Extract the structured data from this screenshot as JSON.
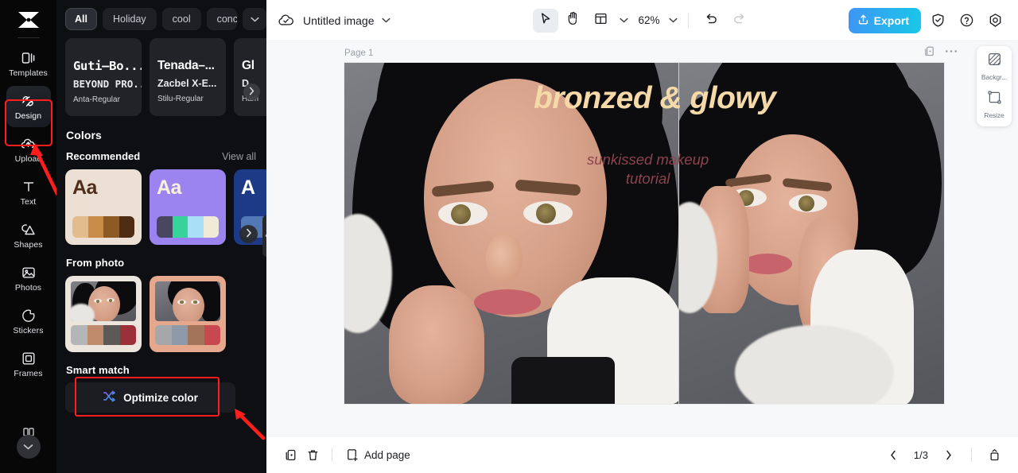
{
  "app": {
    "brand_icon": "capcut-logo-icon",
    "accent": "#ff1d1d",
    "export_gradient_from": "#3e95f5",
    "export_gradient_to": "#18c8e8"
  },
  "rail": {
    "items": [
      {
        "label": "Templates",
        "icon": "templates-icon",
        "active": false
      },
      {
        "label": "Design",
        "icon": "design-icon",
        "active": true
      },
      {
        "label": "Upload",
        "icon": "upload-cloud-icon",
        "active": false
      },
      {
        "label": "Text",
        "icon": "text-icon",
        "active": false
      },
      {
        "label": "Shapes",
        "icon": "shapes-icon",
        "active": false
      },
      {
        "label": "Photos",
        "icon": "photos-icon",
        "active": false
      },
      {
        "label": "Stickers",
        "icon": "stickers-icon",
        "active": false
      },
      {
        "label": "Frames",
        "icon": "frames-icon",
        "active": false
      }
    ],
    "collapse_icon": "chevron-down-icon"
  },
  "panel": {
    "tags": [
      {
        "label": "All",
        "selected": true
      },
      {
        "label": "Holiday",
        "selected": false
      },
      {
        "label": "cool",
        "selected": false
      },
      {
        "label": "concise",
        "selected": false
      }
    ],
    "tag_more_icon": "chevron-down-icon",
    "font_cards": [
      {
        "line1": "Guti–Bo...",
        "line2": "BEYOND PRO...",
        "line3": "Anta-Regular",
        "mono": true
      },
      {
        "line1": "Tenada–...",
        "line2": "Zacbel X-E...",
        "line3": "Stilu-Regular",
        "mono": false
      },
      {
        "line1": "Gl",
        "line2": "D",
        "line3": "Ham",
        "mono": false
      }
    ],
    "colors_heading": "Colors",
    "recommended_label": "Recommended",
    "view_all_label": "View all",
    "palettes": [
      {
        "bg": "#ece0d4",
        "aa": "Aa",
        "aa_color": "#4e2f1c",
        "swatches": [
          "#e3bc8e",
          "#c98b47",
          "#8c5a22",
          "#4e2d12"
        ]
      },
      {
        "bg": "#9b84f0",
        "aa": "Aa",
        "aa_color": "#f6f0dd",
        "swatches": [
          "#4a4560",
          "#36d39b",
          "#a9e0f7",
          "#f1ead6"
        ]
      },
      {
        "bg": "#1d3a86",
        "aa": "A",
        "aa_color": "#ffffff",
        "swatches": [
          "#5279b6"
        ]
      }
    ],
    "from_photo_label": "From photo",
    "photo_palettes": [
      {
        "frame": "#ece5dd",
        "swatches": [
          "#b4b5b7",
          "#c08a6c",
          "#5d5956",
          "#9c3039"
        ]
      },
      {
        "frame": "#e6a88c",
        "swatches": [
          "#a5a7aa",
          "#8e9aa8",
          "#a3745a",
          "#c8484f"
        ]
      }
    ],
    "smart_match_label": "Smart match",
    "optimize_button": {
      "label": "Optimize color",
      "icon": "shuffle-icon"
    },
    "next_arrow_icon": "chevron-right-icon",
    "collapse_handle_icon": "chevron-left-icon"
  },
  "topbar": {
    "cloud_icon": "cloud-saved-icon",
    "title": "Untitled image",
    "title_chevron_icon": "chevron-down-icon",
    "tools": [
      {
        "name": "select-tool",
        "icon": "cursor-arrow-icon",
        "active": true
      },
      {
        "name": "hand-tool",
        "icon": "hand-icon",
        "active": false
      },
      {
        "name": "layout-tool",
        "icon": "layout-grid-icon",
        "active": false
      }
    ],
    "layout_chevron_icon": "chevron-down-icon",
    "zoom_value": "62%",
    "zoom_chevron_icon": "chevron-down-icon",
    "undo_icon": "undo-arrow-icon",
    "redo_icon": "redo-arrow-icon",
    "export_label": "Export",
    "export_icon": "upload-share-icon",
    "right_icons": [
      {
        "name": "shield-check-icon"
      },
      {
        "name": "help-question-icon"
      },
      {
        "name": "settings-gear-icon"
      }
    ]
  },
  "canvas": {
    "page_label": "Page 1",
    "page_actions": [
      {
        "name": "duplicate-page-icon"
      },
      {
        "name": "more-options-icon"
      }
    ],
    "design": {
      "headline": "bronzed & glowy",
      "headline_color": "#f5d9a8",
      "subline_1": "sunkissed makeup",
      "subline_2": "tutorial",
      "subline_color": "#8c4450"
    }
  },
  "rightdock": {
    "items": [
      {
        "label": "Backgr...",
        "icon": "background-icon"
      },
      {
        "label": "Resize",
        "icon": "resize-icon"
      }
    ]
  },
  "bottombar": {
    "duplicate_icon": "duplicate-icon",
    "delete_icon": "trash-icon",
    "add_page_label": "Add page",
    "add_page_icon": "add-page-icon",
    "prev_icon": "chevron-left-icon",
    "page_indicator": "1/3",
    "next_icon": "chevron-right-icon",
    "collapse_icon": "collapse-panel-icon"
  }
}
